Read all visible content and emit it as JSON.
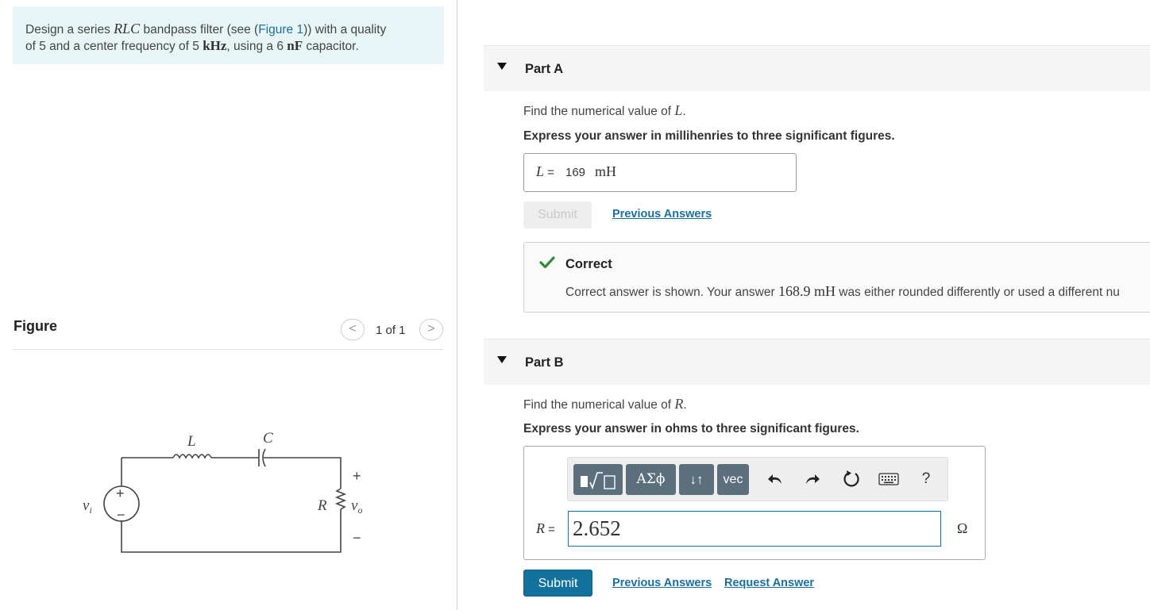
{
  "problem": {
    "t1": "Design a series ",
    "m1": "RLC",
    "t2": " bandpass filter (see (",
    "fig_link": "Figure 1",
    "t3": ")) with a quality",
    "t4": "of 5 and a center frequency of 5 ",
    "m2": "kHz",
    "t5": ", using a 6 ",
    "m3": "nF",
    "t6": " capacitor."
  },
  "figure": {
    "label": "Figure",
    "pager": "1 of 1",
    "prev_icon": "<",
    "next_icon": ">",
    "circuit_labels": {
      "L": "L",
      "C": "C",
      "R": "R",
      "vi": "v",
      "vi_sub": "i",
      "vo": "v",
      "vo_sub": "o",
      "plus": "+",
      "minus": "−"
    }
  },
  "partA": {
    "title": "Part A",
    "prompt": "Find the numerical value of ",
    "prompt_var": "L",
    "prompt_end": ".",
    "instruction": "Express your answer in millihenries to three significant figures.",
    "answer_lhs_var": "L",
    "answer_lhs_eq": " = ",
    "answer_value": "169",
    "answer_unit": "mH",
    "submit_label": "Submit",
    "previous_answers": "Previous Answers",
    "feedback": {
      "title": "Correct",
      "msg1": "Correct answer is shown. Your answer ",
      "msg_num": "168.9 mH",
      "msg2": " was either rounded differently or used a different nu"
    }
  },
  "partB": {
    "title": "Part B",
    "prompt": "Find the numerical value of ",
    "prompt_var": "R",
    "prompt_end": ".",
    "instruction": "Express your answer in ohms to three significant figures.",
    "toolbar": {
      "greek": "ΑΣϕ",
      "arrows": "↓↑",
      "vec": "vec",
      "help": "?"
    },
    "answer_lhs_var": "R",
    "answer_lhs_eq": " = ",
    "answer_value": "2.652",
    "answer_unit": "Ω",
    "submit_label": "Submit",
    "previous_answers": "Previous Answers",
    "request_answer": "Request Answer"
  }
}
